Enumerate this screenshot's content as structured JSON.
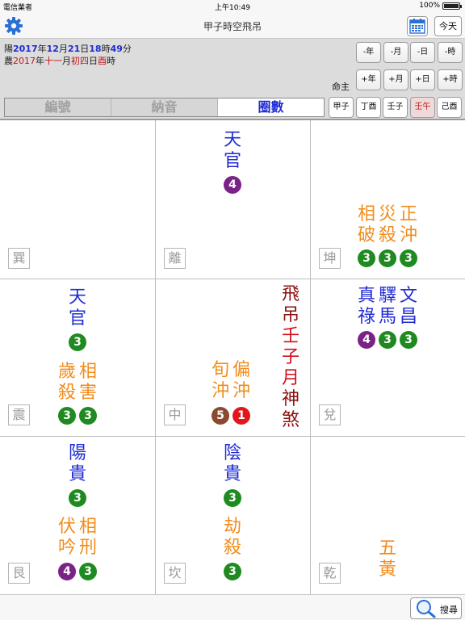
{
  "status": {
    "carrier": "電信業者",
    "time": "上午10:49",
    "battery": "100%"
  },
  "nav": {
    "title": "甲子時空飛吊",
    "today": "今天"
  },
  "date": {
    "solar": {
      "prefix": "陽",
      "year": "2017",
      "y": "年",
      "month": "12",
      "m": "月",
      "day": "21",
      "d": "日",
      "hour": "18",
      "h": "時",
      "minute": "49",
      "mi": "分"
    },
    "lunar": {
      "prefix": "農",
      "year": "2017",
      "y": "年",
      "month": "十一",
      "m": "月",
      "day": "初四",
      "d": "日",
      "hour": "酉",
      "h": "時"
    }
  },
  "adjust": {
    "minus_year": "-年",
    "minus_month": "-月",
    "minus_day": "-日",
    "minus_hour": "-時",
    "plus_year": "+年",
    "plus_month": "+月",
    "plus_day": "+日",
    "plus_hour": "+時"
  },
  "mingzhu": "命主",
  "segments": [
    "編號",
    "納音",
    "圈數"
  ],
  "pillars": [
    "甲子",
    "丁酉",
    "壬子",
    "壬午",
    "己酉"
  ],
  "cells": {
    "xun": {
      "label": "巽"
    },
    "li": {
      "label": "離",
      "g1": {
        "chars": [
          "天",
          "官"
        ],
        "num": "4"
      }
    },
    "kun": {
      "label": "坤",
      "c1": [
        "相",
        "破"
      ],
      "c2": [
        "災",
        "殺"
      ],
      "c3": [
        "正",
        "沖"
      ],
      "nums": [
        "3",
        "3",
        "3"
      ]
    },
    "zhen": {
      "label": "震",
      "g1": {
        "chars": [
          "天",
          "官"
        ],
        "num": "3"
      },
      "c1": [
        "歲",
        "殺"
      ],
      "c2": [
        "相",
        "害"
      ],
      "nums": [
        "3",
        "3"
      ]
    },
    "zhong": {
      "label": "中",
      "c1": [
        "旬",
        "沖"
      ],
      "c2": [
        "偏",
        "沖"
      ],
      "nums": [
        "5",
        "1"
      ],
      "v1": [
        "飛",
        "吊"
      ],
      "v2": [
        "壬",
        "子",
        "月"
      ],
      "v3": [
        "神",
        "煞"
      ]
    },
    "dui": {
      "label": "兌",
      "c1": [
        "真",
        "祿"
      ],
      "c2": [
        "驛",
        "馬"
      ],
      "c3": [
        "文",
        "昌"
      ],
      "nums": [
        "4",
        "3",
        "3"
      ]
    },
    "gen": {
      "label": "艮",
      "g1": {
        "chars": [
          "陽",
          "貴"
        ],
        "num": "3"
      },
      "c1": [
        "伏",
        "吟"
      ],
      "c2": [
        "相",
        "刑"
      ],
      "nums": [
        "4",
        "3"
      ]
    },
    "kan": {
      "label": "坎",
      "g1": {
        "chars": [
          "陰",
          "貴"
        ],
        "num": "3"
      },
      "g2": {
        "chars": [
          "劫",
          "殺"
        ],
        "num": "3"
      }
    },
    "qian": {
      "label": "乾",
      "c1": [
        "五",
        "黃"
      ]
    }
  },
  "bottom": {
    "search": "搜尋"
  },
  "colors": {
    "blue": "#1f2bd4",
    "orange": "#f28c1c",
    "green": "#1f8a1f",
    "purple": "#7b2287",
    "red": "#d1101a"
  }
}
